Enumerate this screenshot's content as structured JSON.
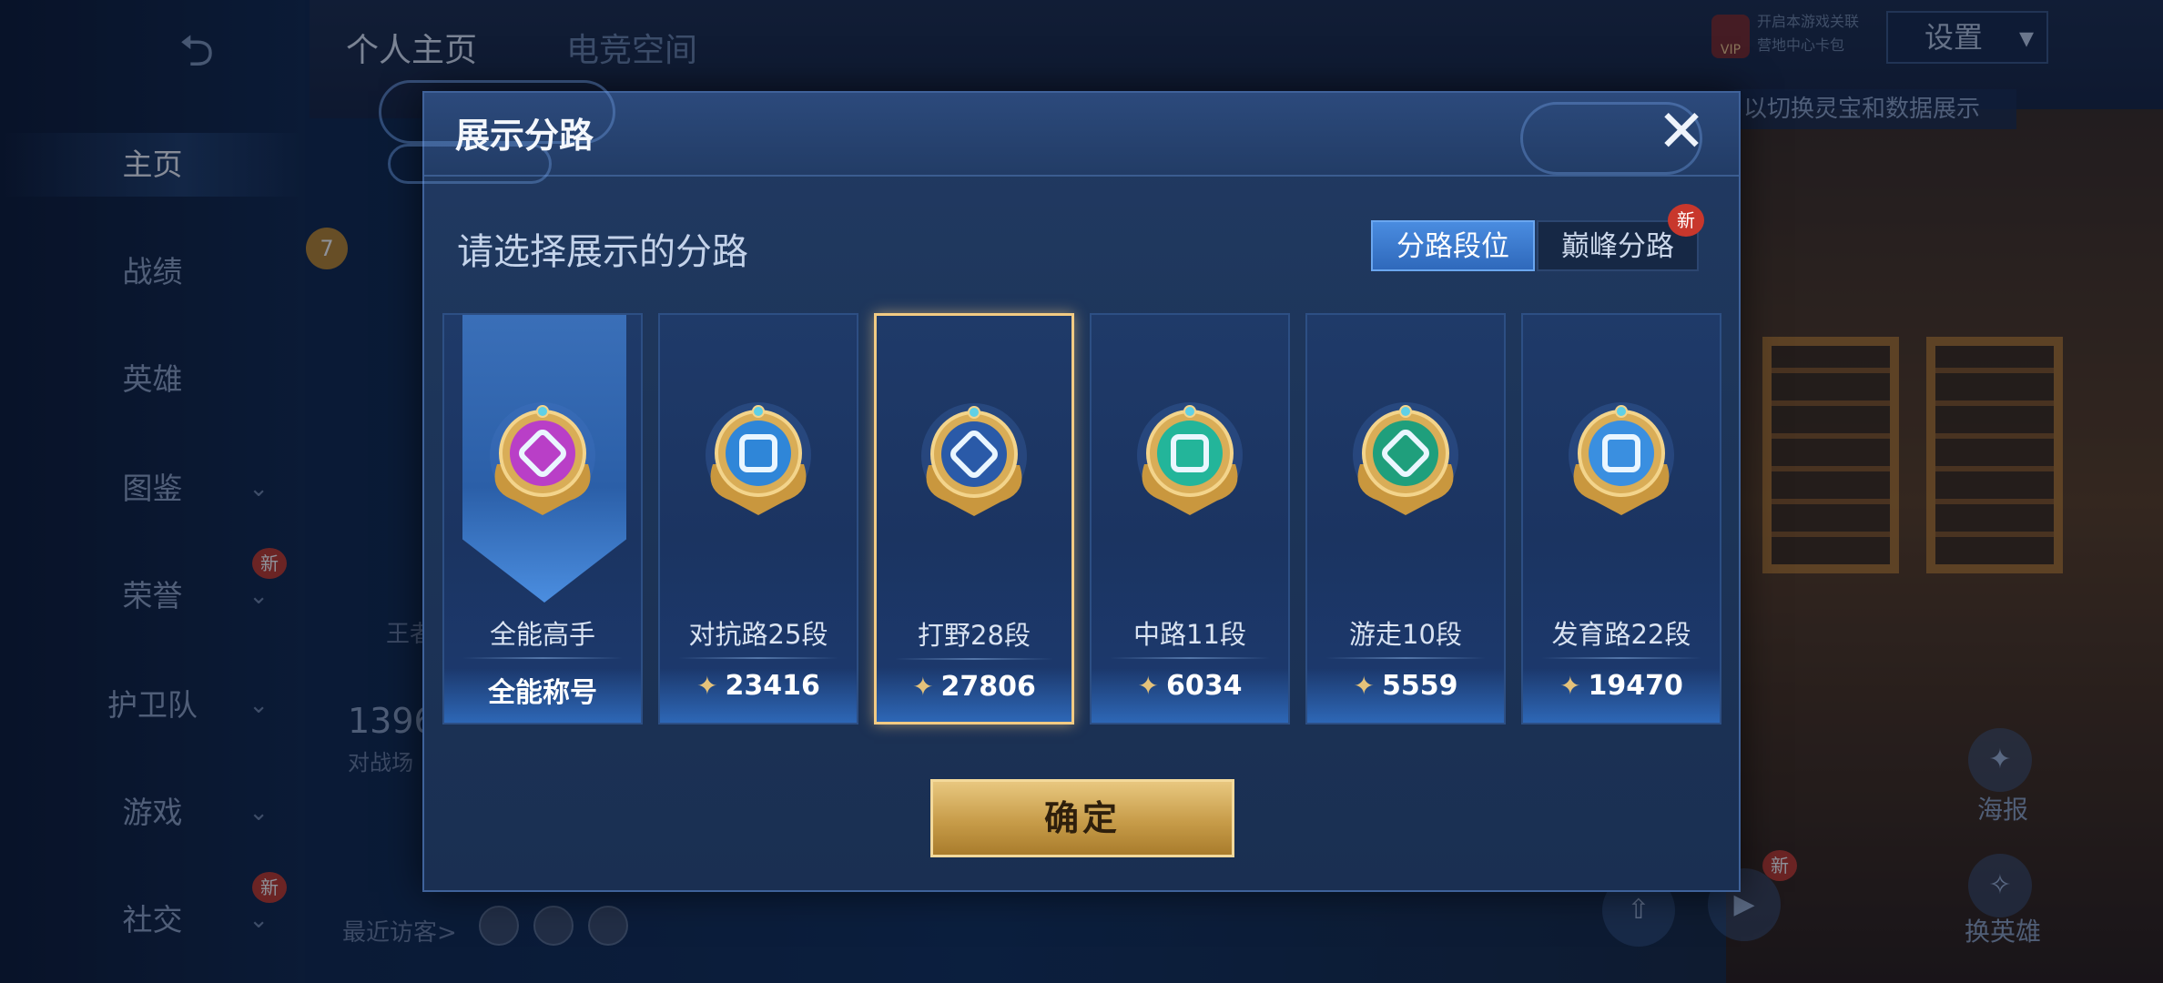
{
  "app": {
    "top_tabs": [
      "个人主页",
      "电竞空间"
    ],
    "settings_label": "设置",
    "vip_lines": [
      "开启本游戏关联",
      "营地中心卡包"
    ],
    "vip_badge": "VIP",
    "hint_text": "以切换灵宝和数据展示"
  },
  "sidebar": {
    "back_icon": "back-arrow-icon",
    "items": [
      {
        "label": "主页",
        "active": true
      },
      {
        "label": "战绩"
      },
      {
        "label": "英雄"
      },
      {
        "label": "图鉴",
        "chevron": true
      },
      {
        "label": "荣誉",
        "chevron": true,
        "new": "新"
      },
      {
        "label": "护卫队",
        "chevron": true
      },
      {
        "label": "游戏",
        "chevron": true
      },
      {
        "label": "社交",
        "chevron": true,
        "new": "新"
      }
    ]
  },
  "background": {
    "level_badge": "7",
    "partial_text_1": "王者",
    "stat_number": "1396",
    "stat_label": "对战场",
    "visitors_label": "最近访客>",
    "poster_label": "海报",
    "switch_hero_label": "换英雄",
    "play_new": "新"
  },
  "modal": {
    "title": "展示分路",
    "close_icon": "close-icon",
    "prompt": "请选择展示的分路",
    "segments": {
      "left": "分路段位",
      "right": "巅峰分路",
      "right_new": "新"
    },
    "cards": [
      {
        "name": "全能高手",
        "value": "全能称号",
        "has_points": false,
        "color": "#b93fc7"
      },
      {
        "name": "对抗路25段",
        "value": "23416",
        "has_points": true,
        "color": "#2f86d8"
      },
      {
        "name": "打野28段",
        "value": "27806",
        "has_points": true,
        "color": "#2a5aa8",
        "selected": true
      },
      {
        "name": "中路11段",
        "value": "6034",
        "has_points": true,
        "color": "#23b59a"
      },
      {
        "name": "游走10段",
        "value": "5559",
        "has_points": true,
        "color": "#1f9f7c"
      },
      {
        "name": "发育路22段",
        "value": "19470",
        "has_points": true,
        "color": "#3a8fe0"
      }
    ],
    "confirm_label": "确定"
  }
}
